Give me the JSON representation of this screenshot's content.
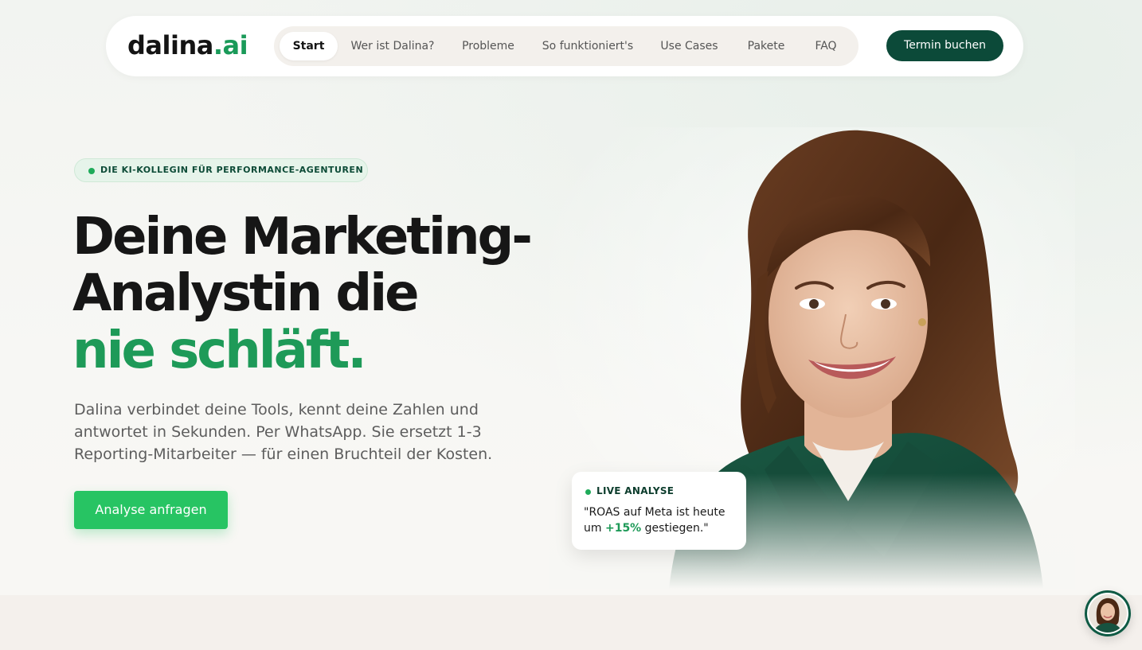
{
  "brand": {
    "logo_main": "dalina",
    "logo_accent": ".ai",
    "accent_color": "#1e9a58",
    "dark_color": "#0c4a39",
    "cta_color": "#27c463"
  },
  "nav": {
    "items": [
      {
        "label": "Start",
        "active": true
      },
      {
        "label": "Wer ist Dalina?",
        "active": false
      },
      {
        "label": "Probleme",
        "active": false
      },
      {
        "label": "So funktioniert's",
        "active": false
      },
      {
        "label": "Use Cases",
        "active": false
      },
      {
        "label": "Pakete",
        "active": false
      },
      {
        "label": "FAQ",
        "active": false
      }
    ],
    "cta_label": "Termin buchen"
  },
  "hero": {
    "badge": "DIE KI-KOLLEGIN FÜR PERFORMANCE-AGENTUREN",
    "headline_line1": "Deine Marketing-",
    "headline_line2": "Analystin die",
    "headline_line3": "nie schläft.",
    "subtext": "Dalina verbindet deine Tools, kennt deine Zahlen und antwortet in Sekunden. Per WhatsApp. Sie ersetzt 1-3 Reporting-Mitarbeiter — für einen Bruchteil der Kosten.",
    "cta_label": "Analyse anfragen"
  },
  "live_card": {
    "label": "LIVE ANALYSE",
    "quote_before": "\"ROAS auf Meta ist heute um ",
    "quote_highlight": "+15%",
    "quote_after": " gestiegen.\""
  },
  "icons": {
    "chat_avatar": "avatar-icon",
    "live_dot": "status-dot-icon"
  }
}
